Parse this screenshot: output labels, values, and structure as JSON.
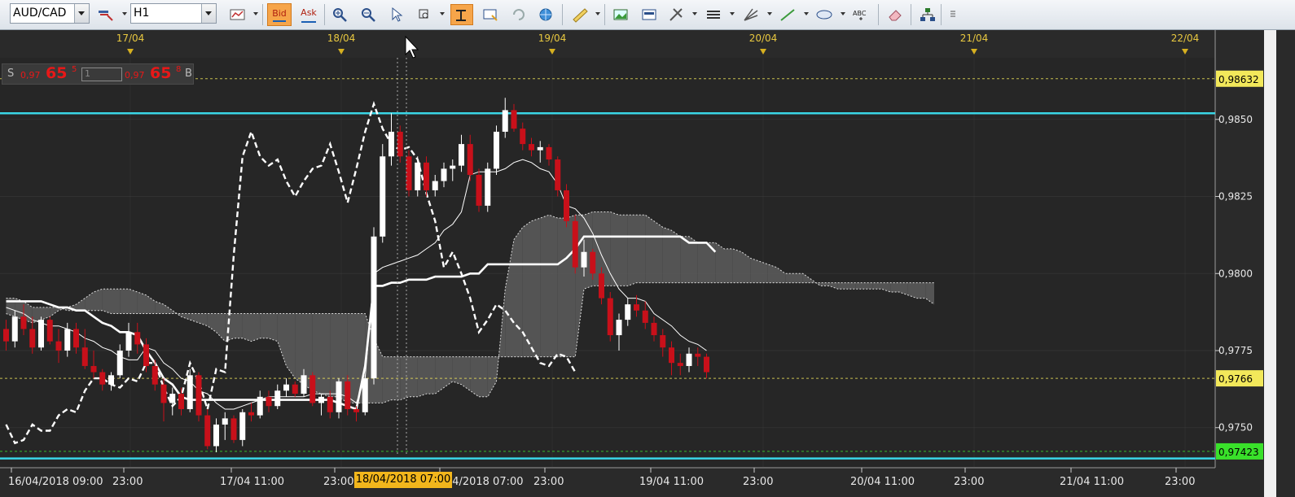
{
  "toolbar": {
    "symbol": "AUD/CAD",
    "timeframe": "H1",
    "bid_label": "Bid",
    "ask_label": "Ask",
    "text_tool_label": "ABC"
  },
  "quote": {
    "sell_label": "S",
    "sell_prefix": "0,97",
    "sell_big": "65",
    "sell_sup": "5",
    "lot": "1",
    "buy_prefix": "0,97",
    "buy_big": "65",
    "buy_sup": "8",
    "buy_label": "B"
  },
  "colors": {
    "background": "#2a2a2a",
    "bull_candle": "#ffffff",
    "bear_candle": "#c8101a",
    "cloud": "#5a5a5a",
    "resistance_line": "#3ad6e6",
    "price_tag": "#f2e85a",
    "green_tag": "#39e12a",
    "grid": "#555555"
  },
  "chart_data": {
    "type": "candlestick",
    "symbol": "AUD/CAD",
    "timeframe": "H1",
    "ylim": [
      0.9737,
      0.987
    ],
    "date_markers": [
      "17/04",
      "18/04",
      "19/04",
      "20/04",
      "21/04",
      "22/04"
    ],
    "x_tick_labels": [
      "16/04/2018 09:00",
      "23:00",
      "17/04 11:00",
      "23:00",
      "18/04/2018 07:00",
      "23:00",
      "19/04 11:00",
      "23:00",
      "20/04 11:00",
      "23:00",
      "21/04 11:00",
      "23:00"
    ],
    "y_ticks": [
      {
        "value": 0.975,
        "label": "0,9750"
      },
      {
        "value": 0.9775,
        "label": "0,9775"
      },
      {
        "value": 0.98,
        "label": "0,9800"
      },
      {
        "value": 0.9825,
        "label": "0,9825"
      },
      {
        "value": 0.985,
        "label": "0,9850"
      }
    ],
    "price_tags": [
      {
        "value": 0.98632,
        "label": "0,98632",
        "color": "#f2e85a"
      },
      {
        "value": 0.97423,
        "label": "0,97423",
        "color": "#39e12a"
      },
      {
        "value": 0.9766,
        "label": "0,9766",
        "color": "#f2e85a"
      }
    ],
    "horizontal_lines": [
      {
        "value": 0.9852,
        "color": "#3ad6e6"
      },
      {
        "value": 0.974,
        "color": "#3ad6e6"
      }
    ],
    "crosshair_time_label": "18/04/2018 07:00",
    "candles": [
      [
        0.9782,
        0.9785,
        0.9775,
        0.9778
      ],
      [
        0.9778,
        0.9788,
        0.9776,
        0.9786
      ],
      [
        0.9786,
        0.979,
        0.978,
        0.9782
      ],
      [
        0.9782,
        0.9786,
        0.9774,
        0.9776
      ],
      [
        0.9776,
        0.9786,
        0.9775,
        0.9785
      ],
      [
        0.9785,
        0.9786,
        0.9777,
        0.9778
      ],
      [
        0.9778,
        0.9782,
        0.9771,
        0.9775
      ],
      [
        0.9775,
        0.9784,
        0.9773,
        0.9782
      ],
      [
        0.9782,
        0.9784,
        0.9774,
        0.9776
      ],
      [
        0.9776,
        0.9782,
        0.9769,
        0.977
      ],
      [
        0.977,
        0.9775,
        0.9766,
        0.9768
      ],
      [
        0.9768,
        0.9769,
        0.9762,
        0.9764
      ],
      [
        0.9764,
        0.9768,
        0.9762,
        0.9767
      ],
      [
        0.9767,
        0.9777,
        0.9766,
        0.9775
      ],
      [
        0.9775,
        0.9784,
        0.9773,
        0.9781
      ],
      [
        0.9781,
        0.9784,
        0.9774,
        0.9777
      ],
      [
        0.9777,
        0.9779,
        0.9768,
        0.977
      ],
      [
        0.977,
        0.9772,
        0.9762,
        0.9764
      ],
      [
        0.9764,
        0.9766,
        0.9752,
        0.9758
      ],
      [
        0.9758,
        0.9763,
        0.9754,
        0.9761
      ],
      [
        0.9761,
        0.9763,
        0.9754,
        0.9756
      ],
      [
        0.9756,
        0.9769,
        0.9755,
        0.9767
      ],
      [
        0.9767,
        0.9768,
        0.9752,
        0.9754
      ],
      [
        0.9754,
        0.9756,
        0.9743,
        0.9744
      ],
      [
        0.9744,
        0.9753,
        0.9742,
        0.9751
      ],
      [
        0.9751,
        0.9755,
        0.9746,
        0.9753
      ],
      [
        0.9753,
        0.9754,
        0.9745,
        0.9746
      ],
      [
        0.9746,
        0.9756,
        0.9744,
        0.9755
      ],
      [
        0.9755,
        0.9758,
        0.9752,
        0.9754
      ],
      [
        0.9754,
        0.9762,
        0.9753,
        0.976
      ],
      [
        0.976,
        0.9762,
        0.9755,
        0.9757
      ],
      [
        0.9757,
        0.9764,
        0.9756,
        0.9762
      ],
      [
        0.9762,
        0.9766,
        0.976,
        0.9764
      ],
      [
        0.9764,
        0.9765,
        0.976,
        0.9761
      ],
      [
        0.9761,
        0.9769,
        0.976,
        0.9767
      ],
      [
        0.9767,
        0.9768,
        0.9757,
        0.9758
      ],
      [
        0.9758,
        0.9761,
        0.9754,
        0.976
      ],
      [
        0.976,
        0.9762,
        0.9753,
        0.9755
      ],
      [
        0.9755,
        0.9766,
        0.9753,
        0.9765
      ],
      [
        0.9765,
        0.9767,
        0.9754,
        0.9756
      ],
      [
        0.9756,
        0.9757,
        0.9752,
        0.9755
      ],
      [
        0.9755,
        0.9767,
        0.9754,
        0.9766
      ],
      [
        0.9766,
        0.9815,
        0.9764,
        0.9812
      ],
      [
        0.9812,
        0.9842,
        0.981,
        0.9838
      ],
      [
        0.9838,
        0.9852,
        0.9835,
        0.9846
      ],
      [
        0.9846,
        0.9848,
        0.9836,
        0.9838
      ],
      [
        0.9838,
        0.984,
        0.9825,
        0.9827
      ],
      [
        0.9827,
        0.9838,
        0.9825,
        0.9836
      ],
      [
        0.9836,
        0.9838,
        0.9825,
        0.9827
      ],
      [
        0.9827,
        0.9832,
        0.9825,
        0.983
      ],
      [
        0.983,
        0.9836,
        0.9828,
        0.9834
      ],
      [
        0.9834,
        0.9837,
        0.983,
        0.9835
      ],
      [
        0.9835,
        0.9845,
        0.9833,
        0.9842
      ],
      [
        0.9842,
        0.9845,
        0.983,
        0.9832
      ],
      [
        0.9832,
        0.9834,
        0.982,
        0.9822
      ],
      [
        0.9822,
        0.9836,
        0.982,
        0.9834
      ],
      [
        0.9834,
        0.9848,
        0.9832,
        0.9846
      ],
      [
        0.9846,
        0.9857,
        0.9844,
        0.9853
      ],
      [
        0.9853,
        0.9855,
        0.9846,
        0.9847
      ],
      [
        0.9847,
        0.9849,
        0.984,
        0.9842
      ],
      [
        0.9842,
        0.9844,
        0.9838,
        0.984
      ],
      [
        0.984,
        0.9843,
        0.9836,
        0.9841
      ],
      [
        0.9841,
        0.9842,
        0.9835,
        0.9837
      ],
      [
        0.9837,
        0.9838,
        0.9825,
        0.9827
      ],
      [
        0.9827,
        0.9829,
        0.9815,
        0.9817
      ],
      [
        0.9817,
        0.9819,
        0.98,
        0.9802
      ],
      [
        0.9802,
        0.9811,
        0.9799,
        0.9807
      ],
      [
        0.9807,
        0.9808,
        0.9798,
        0.98
      ],
      [
        0.98,
        0.9802,
        0.979,
        0.9792
      ],
      [
        0.9792,
        0.9794,
        0.9778,
        0.978
      ],
      [
        0.978,
        0.9787,
        0.9775,
        0.9785
      ],
      [
        0.9785,
        0.9792,
        0.9783,
        0.979
      ],
      [
        0.979,
        0.9793,
        0.9786,
        0.9788
      ],
      [
        0.9788,
        0.9791,
        0.9782,
        0.9784
      ],
      [
        0.9784,
        0.9786,
        0.9778,
        0.978
      ],
      [
        0.978,
        0.9782,
        0.9773,
        0.9776
      ],
      [
        0.9776,
        0.9778,
        0.9767,
        0.9771
      ],
      [
        0.9771,
        0.9774,
        0.9767,
        0.977
      ],
      [
        0.977,
        0.9776,
        0.9768,
        0.9774
      ],
      [
        0.9774,
        0.9776,
        0.977,
        0.9773
      ],
      [
        0.9773,
        0.9774,
        0.9766,
        0.9768
      ]
    ],
    "tenkan": [
      0.9789,
      0.9788,
      0.9787,
      0.9785,
      0.9784,
      0.9783,
      0.9783,
      0.9782,
      0.9781,
      0.9779,
      0.9778,
      0.9776,
      0.9775,
      0.9773,
      0.9772,
      0.9772,
      0.9776,
      0.9775,
      0.9771,
      0.9769,
      0.9766,
      0.9765,
      0.9762,
      0.9761,
      0.9758,
      0.9756,
      0.9756,
      0.9757,
      0.9758,
      0.9759,
      0.976,
      0.976,
      0.976,
      0.976,
      0.976,
      0.9761,
      0.9761,
      0.9761,
      0.9761,
      0.976,
      0.9758,
      0.9766,
      0.98,
      0.9802,
      0.9803,
      0.9804,
      0.9805,
      0.9806,
      0.9808,
      0.981,
      0.9814,
      0.9816,
      0.982,
      0.9832,
      0.9833,
      0.9833,
      0.9833,
      0.9834,
      0.9836,
      0.9837,
      0.9836,
      0.9834,
      0.9833,
      0.9829,
      0.9822,
      0.9821,
      0.9818,
      0.9813,
      0.9806,
      0.98,
      0.9795,
      0.9792,
      0.9792,
      0.9791,
      0.9787,
      0.9785,
      0.9783,
      0.978,
      0.9778,
      0.9777,
      0.9775
    ],
    "kijun": [
      0.9791,
      0.9791,
      0.9791,
      0.9791,
      0.9791,
      0.979,
      0.9789,
      0.9789,
      0.9788,
      0.9788,
      0.9786,
      0.9784,
      0.9783,
      0.9781,
      0.9781,
      0.978,
      0.9775,
      0.9771,
      0.9766,
      0.9764,
      0.976,
      0.9759,
      0.9759,
      0.9759,
      0.9759,
      0.9759,
      0.9759,
      0.9759,
      0.9759,
      0.9759,
      0.9759,
      0.9759,
      0.9759,
      0.9759,
      0.9759,
      0.9759,
      0.9759,
      0.9759,
      0.9758,
      0.9757,
      0.9756,
      0.977,
      0.9796,
      0.9796,
      0.9797,
      0.9797,
      0.9798,
      0.9798,
      0.9798,
      0.9799,
      0.9799,
      0.9799,
      0.9799,
      0.98,
      0.98,
      0.9803,
      0.9803,
      0.9803,
      0.9803,
      0.9803,
      0.9803,
      0.9803,
      0.9803,
      0.9803,
      0.9805,
      0.9808,
      0.9812,
      0.9812,
      0.9812,
      0.9812,
      0.9812,
      0.9812,
      0.9812,
      0.9812,
      0.9812,
      0.9812,
      0.9812,
      0.9812,
      0.981,
      0.981,
      0.981,
      0.9807
    ],
    "chikou": [
      0.9751,
      0.9745,
      0.9746,
      0.9751,
      0.9749,
      0.9749,
      0.9754,
      0.9756,
      0.9755,
      0.9762,
      0.9766,
      0.9766,
      0.9764,
      0.9763,
      0.9766,
      0.9765,
      0.9771,
      0.9771,
      0.9763,
      0.9757,
      0.976,
      0.9771,
      0.9765,
      0.9756,
      0.9769,
      0.9768,
      0.9806,
      0.9838,
      0.9846,
      0.9838,
      0.9835,
      0.9837,
      0.983,
      0.9825,
      0.983,
      0.9834,
      0.9835,
      0.9842,
      0.9833,
      0.9823,
      0.9834,
      0.9846,
      0.9855,
      0.9847,
      0.9842,
      0.984,
      0.9841,
      0.9837,
      0.9826,
      0.9817,
      0.9802,
      0.9807,
      0.98,
      0.9792,
      0.9781,
      0.9785,
      0.979,
      0.9788,
      0.9784,
      0.9781,
      0.9776,
      0.9771,
      0.977,
      0.9774,
      0.9773,
      0.9768
    ],
    "senkou_a": [
      0.9792,
      0.9792,
      0.9791,
      0.9789,
      0.9789,
      0.9789,
      0.9789,
      0.9788,
      0.9788,
      0.9788,
      0.9788,
      0.9788,
      0.9787,
      0.9787,
      0.9787,
      0.9787,
      0.9787,
      0.9787,
      0.9787,
      0.9787,
      0.9787,
      0.9787,
      0.9787,
      0.9787,
      0.9787,
      0.9787,
      0.9787,
      0.9787,
      0.9787,
      0.9787,
      0.9787,
      0.9787,
      0.9787,
      0.9787,
      0.9787,
      0.9787,
      0.9787,
      0.9787,
      0.9787,
      0.9787,
      0.9787,
      0.9787,
      0.9779,
      0.9773,
      0.9773,
      0.9773,
      0.9773,
      0.9773,
      0.9773,
      0.9773,
      0.9773,
      0.9773,
      0.9773,
      0.9773,
      0.9773,
      0.9773,
      0.9773,
      0.9773,
      0.9773,
      0.9773,
      0.9773,
      0.9773,
      0.9773,
      0.9773,
      0.9773,
      0.9773,
      0.9795,
      0.9796,
      0.9796,
      0.9796,
      0.9796,
      0.9796,
      0.9797,
      0.9797,
      0.9797,
      0.9797,
      0.9797,
      0.9797,
      0.9797,
      0.9797,
      0.9797,
      0.9797,
      0.9797,
      0.9797,
      0.9797,
      0.9797,
      0.9797,
      0.9797,
      0.9797,
      0.9797,
      0.9797,
      0.9797,
      0.9797,
      0.9797,
      0.9797,
      0.9797,
      0.9797,
      0.9797,
      0.9797,
      0.9797,
      0.9797,
      0.9797,
      0.9797,
      0.9797,
      0.9797,
      0.9797,
      0.9797
    ],
    "senkou_b": [
      0.9787,
      0.9786,
      0.9785,
      0.9784,
      0.9785,
      0.9786,
      0.9788,
      0.9789,
      0.979,
      0.9792,
      0.9794,
      0.9795,
      0.9795,
      0.9795,
      0.9795,
      0.9794,
      0.9793,
      0.9791,
      0.979,
      0.9788,
      0.9786,
      0.9785,
      0.9784,
      0.9783,
      0.9781,
      0.9778,
      0.9779,
      0.9779,
      0.9778,
      0.9779,
      0.9779,
      0.9778,
      0.977,
      0.9766,
      0.9764,
      0.9762,
      0.9761,
      0.976,
      0.976,
      0.9758,
      0.9758,
      0.9758,
      0.9758,
      0.9758,
      0.9759,
      0.9759,
      0.976,
      0.976,
      0.9761,
      0.9761,
      0.9763,
      0.9765,
      0.9764,
      0.9762,
      0.976,
      0.976,
      0.9765,
      0.9795,
      0.9811,
      0.9815,
      0.9817,
      0.9818,
      0.9819,
      0.9818,
      0.9818,
      0.9819,
      0.9819,
      0.982,
      0.982,
      0.982,
      0.9819,
      0.9819,
      0.9819,
      0.9819,
      0.9817,
      0.9815,
      0.9814,
      0.9812,
      0.9812,
      0.981,
      0.981,
      0.981,
      0.9808,
      0.9808,
      0.9807,
      0.9805,
      0.9804,
      0.9803,
      0.9802,
      0.98,
      0.98,
      0.98,
      0.9798,
      0.9796,
      0.9796,
      0.9795,
      0.9795,
      0.9795,
      0.9795,
      0.9795,
      0.9795,
      0.9794,
      0.9794,
      0.9793,
      0.9792,
      0.9792,
      0.979
    ]
  }
}
